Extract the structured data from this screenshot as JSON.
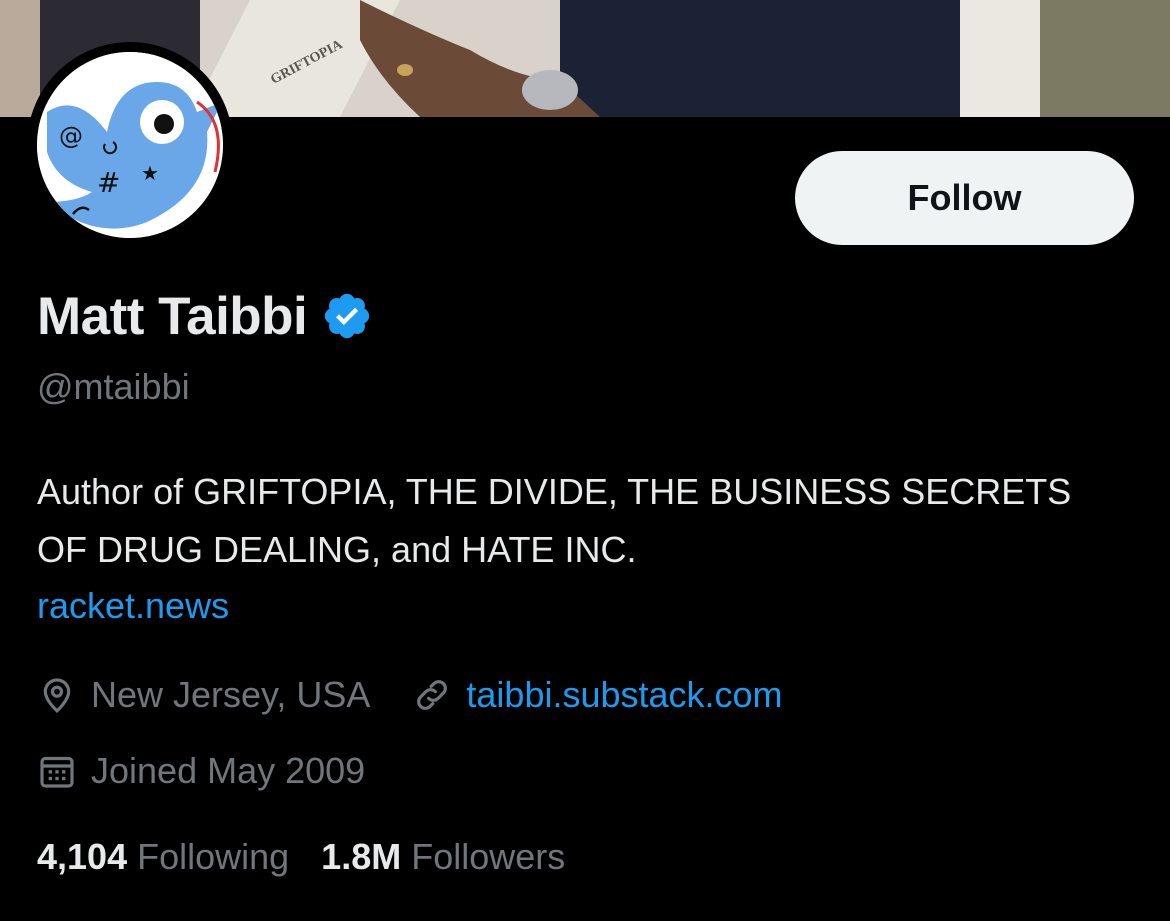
{
  "banner": {
    "book_text": "GRIFTOPIA"
  },
  "avatar": {
    "icon_glyphs": [
      "@",
      "#",
      "★"
    ]
  },
  "header": {
    "follow_label": "Follow"
  },
  "profile": {
    "display_name": "Matt Taibbi",
    "verified": true,
    "handle": "@mtaibbi",
    "bio": "Author of GRIFTOPIA, THE DIVIDE, THE BUSINESS SECRETS OF DRUG DEALING, and HATE INC.",
    "bio_link": "racket.news",
    "location": "New Jersey, USA",
    "website": "taibbi.substack.com",
    "joined": "Joined May 2009"
  },
  "stats": {
    "following_count": "4,104",
    "following_label": "Following",
    "followers_count": "1.8M",
    "followers_label": "Followers"
  },
  "colors": {
    "background": "#000000",
    "text_primary": "#e7e9ea",
    "text_secondary": "#71767b",
    "link": "#1d9bf0",
    "follow_button_bg": "#eff3f4",
    "verified_badge": "#1d9bf0"
  }
}
